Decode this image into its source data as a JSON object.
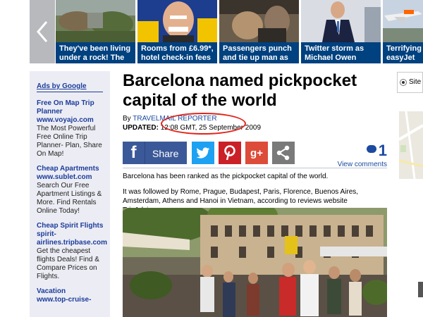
{
  "carousel": {
    "slides": [
      {
        "caption": "They've been living under a rock! The"
      },
      {
        "caption": "Rooms from £6.99*, hotel check-in fees"
      },
      {
        "caption": "Passengers punch and tie up man as"
      },
      {
        "caption": "Twitter storm as Michael Owen"
      },
      {
        "caption": "Terrifying easyJet pl"
      }
    ]
  },
  "ads": {
    "title": "Ads by Google",
    "items": [
      {
        "title": "Free On Map Trip Planner",
        "url": "www.voyajo.com",
        "text": "The Most Powerful Free Online Trip Planner- Plan, Share On Map!"
      },
      {
        "title": "Cheap Apartments",
        "url": "www.sublet.com",
        "text": "Search Our Free Apartment Listings & More. Find Rentals Online Today!"
      },
      {
        "title": "Cheap Spirit Flights",
        "url": "spirit-airlines.tripbase.com",
        "text": "Get the cheapest flights Deals! Find & Compare Prices on Flights."
      },
      {
        "title": "Vacation",
        "url": "www.top-cruise-",
        "text": ""
      }
    ]
  },
  "article": {
    "headline": "Barcelona named pickpocket capital of the world",
    "by_prefix": "By",
    "author": "TRAVELMAIL REPORTER",
    "updated_label": "UPDATED:",
    "updated_value": "12:08 GMT, 25 September 2009",
    "paragraphs": [
      "Barcelona has been ranked as the pickpocket capital of the world.",
      "It was followed by Rome, Prague, Budapest, Paris, Florence, Buenos Aires, Amsterdam, Athens and Hanoi in Vietnam, according to reviews website TripAdvisor.com."
    ]
  },
  "share": {
    "facebook_label": "Share",
    "google_plus_label": "g+",
    "comment_count": "1",
    "view_comments": "View comments"
  },
  "right": {
    "search_option": "Site"
  },
  "colors": {
    "caption_bg": "#00417f",
    "link_blue": "#1b4aa0",
    "highlight_circle": "#e2231a"
  }
}
